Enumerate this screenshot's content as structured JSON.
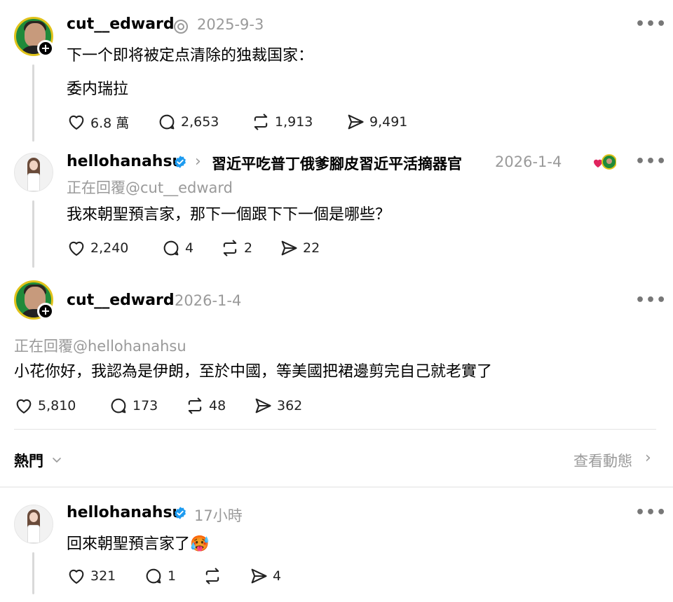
{
  "posts": [
    {
      "username": "cut__edward",
      "time": "2025-9-3",
      "lines": [
        "下一个即将被定点清除的独裁国家：",
        "委内瑞拉"
      ],
      "stats": {
        "likes": "6.8 萬",
        "comments": "2,653",
        "reposts": "1,913",
        "shares": "9,491"
      }
    },
    {
      "username": "hellohanahsu",
      "topic": "習近平吃普丁俄爹腳皮習近平活摘器官",
      "time": "2026-1-4",
      "reply_to": "正在回覆@cut__edward",
      "lines": [
        "我來朝聖預言家，那下一個跟下下一個是哪些？"
      ],
      "stats": {
        "likes": "2,240",
        "comments": "4",
        "reposts": "2",
        "shares": "22"
      }
    },
    {
      "username": "cut__edward",
      "time": "2026-1-4",
      "reply_to": "正在回覆@hellohanahsu",
      "lines": [
        "小花你好，我認為是伊朗，至於中國，等美國把裙邊剪完自己就老實了"
      ],
      "stats": {
        "likes": "5,810",
        "comments": "173",
        "reposts": "48",
        "shares": "362"
      }
    },
    {
      "username": "hellohanahsu",
      "time": "17小時",
      "lines": [
        "回來朝聖預言家了🥵"
      ],
      "stats": {
        "likes": "321",
        "comments": "1",
        "reposts": "",
        "shares": "4"
      }
    }
  ],
  "section": {
    "hot_label": "熱門",
    "view_activity": "查看動態"
  },
  "colors": {
    "verified": "#1d9bf0",
    "muted": "#9a9a9a",
    "line": "#d9d9d9"
  }
}
